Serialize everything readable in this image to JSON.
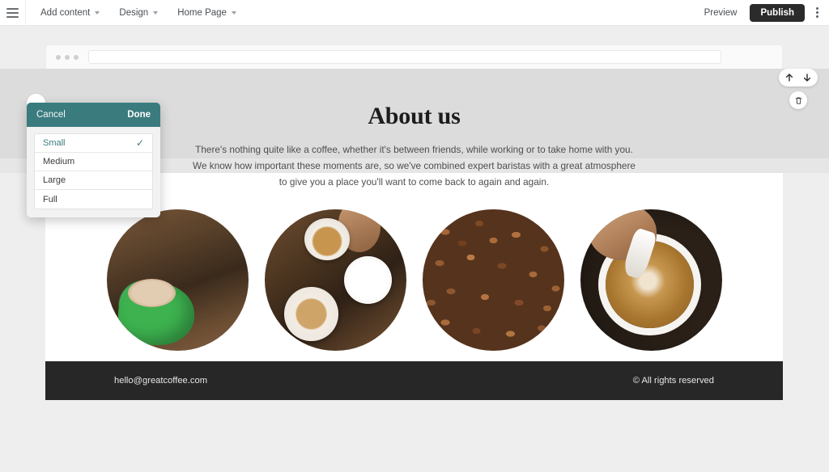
{
  "toolbar": {
    "hamburger_icon": "hamburger-menu-icon",
    "items": [
      {
        "label": "Add content",
        "caret": true
      },
      {
        "label": "Design",
        "caret": true
      },
      {
        "label": "Home Page",
        "caret": true
      }
    ],
    "preview_label": "Preview",
    "publish_label": "Publish",
    "kebab_icon": "more-options-icon"
  },
  "browser_mock": {
    "url_value": "",
    "url_placeholder": ""
  },
  "page": {
    "title": "About us",
    "body": "There's nothing quite like a coffee, whether it's between friends, while working or to take home with you. We know how important these moments are, so we've combined expert baristas with a great atmosphere to give you a place you'll want to come back to again and again.",
    "images": [
      {
        "alt": "green-cup-cappuccino-on-wooden-table"
      },
      {
        "alt": "latte-cup-and-saucer-top-down"
      },
      {
        "alt": "roasted-coffee-beans"
      },
      {
        "alt": "barista-pouring-latte-art"
      }
    ],
    "footer": {
      "email": "hello@greatcoffee.com",
      "rights": "© All rights reserved"
    }
  },
  "section_controls": {
    "move_up_icon": "arrow-up-icon",
    "move_down_icon": "arrow-down-icon",
    "delete_icon": "trash-icon"
  },
  "size_popup": {
    "cancel_label": "Cancel",
    "done_label": "Done",
    "selected": "Small",
    "check_glyph": "✓",
    "options": [
      {
        "label": "Small",
        "selected": true
      },
      {
        "label": "Medium",
        "selected": false
      },
      {
        "label": "Large",
        "selected": false
      },
      {
        "label": "Full",
        "selected": false
      }
    ]
  },
  "colors": {
    "accent_teal": "#3a7b7e",
    "publish_bg": "#2b2b2b",
    "footer_bg": "#272727",
    "canvas_bg": "#eeeeee",
    "selection_band": "#dcdcdc"
  }
}
